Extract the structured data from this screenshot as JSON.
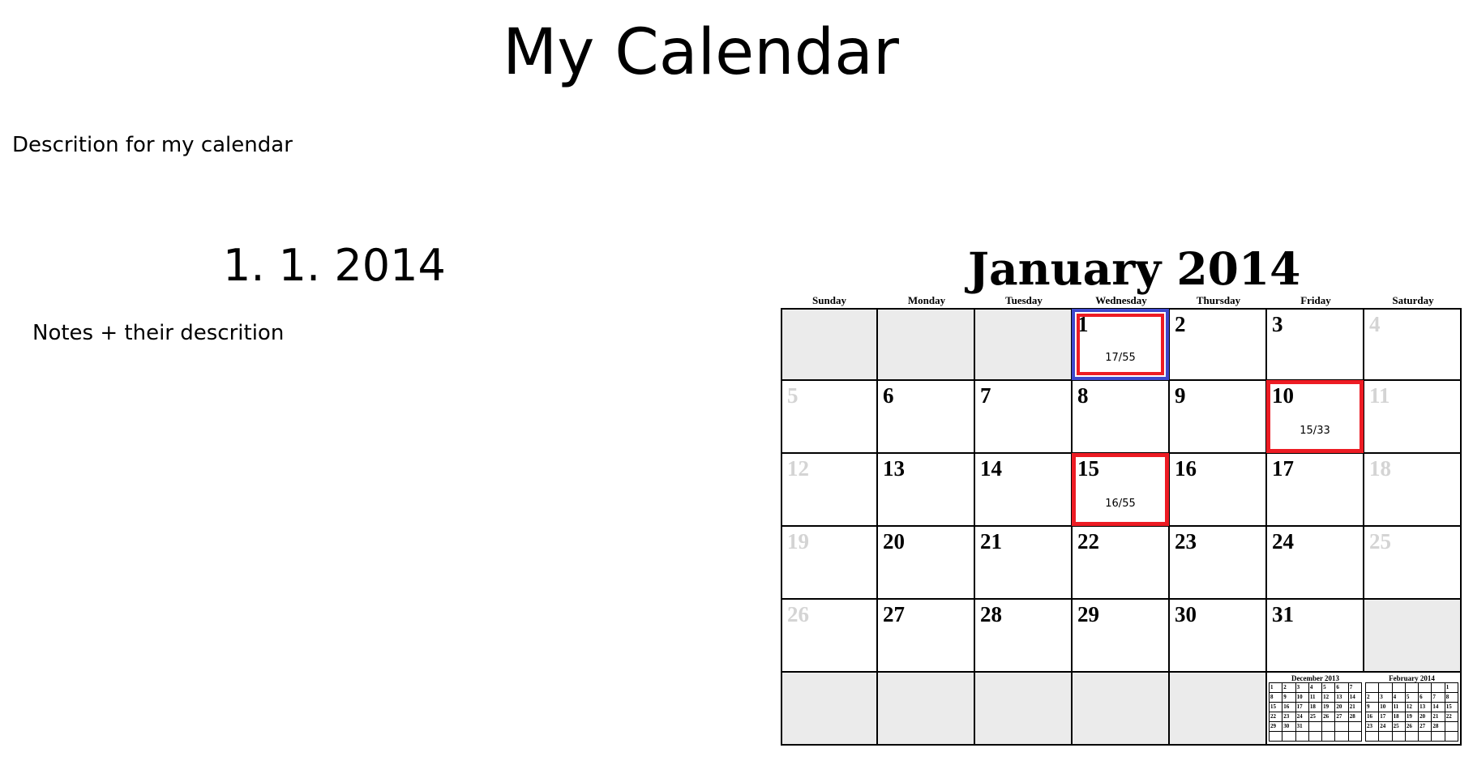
{
  "page": {
    "title": "My Calendar",
    "description": "Descrition for my calendar"
  },
  "selected": {
    "date": "1. 1. 2014",
    "notes_label": "Notes + their descrition"
  },
  "calendar": {
    "title": "January  2014",
    "weekdays": [
      "Sunday",
      "Monday",
      "Tuesday",
      "Wednesday",
      "Thursday",
      "Friday",
      "Saturday"
    ],
    "weeks": [
      [
        null,
        null,
        null,
        1,
        2,
        3,
        4
      ],
      [
        5,
        6,
        7,
        8,
        9,
        10,
        11
      ],
      [
        12,
        13,
        14,
        15,
        16,
        17,
        18
      ],
      [
        19,
        20,
        21,
        22,
        23,
        24,
        25
      ],
      [
        26,
        27,
        28,
        29,
        30,
        31,
        null
      ],
      [
        null,
        null,
        null,
        null,
        null,
        "mini",
        "mini"
      ]
    ],
    "selected_day": 1,
    "events": [
      {
        "day": 1,
        "text": "17/55"
      },
      {
        "day": 10,
        "text": "15/33"
      },
      {
        "day": 15,
        "text": "16/55"
      }
    ],
    "colors": {
      "highlight": "#ed1c24",
      "selected": "#3f48cc",
      "empty": "#ebebeb",
      "weekend_day": "#d4d4d4"
    },
    "mini_calendars": [
      {
        "title": "December 2013",
        "rows": [
          [
            "1",
            "2",
            "3",
            "4",
            "5",
            "6",
            "7"
          ],
          [
            "8",
            "9",
            "10",
            "11",
            "12",
            "13",
            "14"
          ],
          [
            "15",
            "16",
            "17",
            "18",
            "19",
            "20",
            "21"
          ],
          [
            "22",
            "23",
            "24",
            "25",
            "26",
            "27",
            "28"
          ],
          [
            "29",
            "30",
            "31",
            "",
            "",
            "",
            ""
          ],
          [
            "",
            "",
            "",
            "",
            "",
            "",
            ""
          ]
        ]
      },
      {
        "title": "February 2014",
        "rows": [
          [
            "",
            "",
            "",
            "",
            "",
            "",
            "1"
          ],
          [
            "2",
            "3",
            "4",
            "5",
            "6",
            "7",
            "8"
          ],
          [
            "9",
            "10",
            "11",
            "12",
            "13",
            "14",
            "15"
          ],
          [
            "16",
            "17",
            "18",
            "19",
            "20",
            "21",
            "22"
          ],
          [
            "23",
            "24",
            "25",
            "26",
            "27",
            "28",
            ""
          ],
          [
            "",
            "",
            "",
            "",
            "",
            "",
            ""
          ]
        ]
      }
    ]
  }
}
